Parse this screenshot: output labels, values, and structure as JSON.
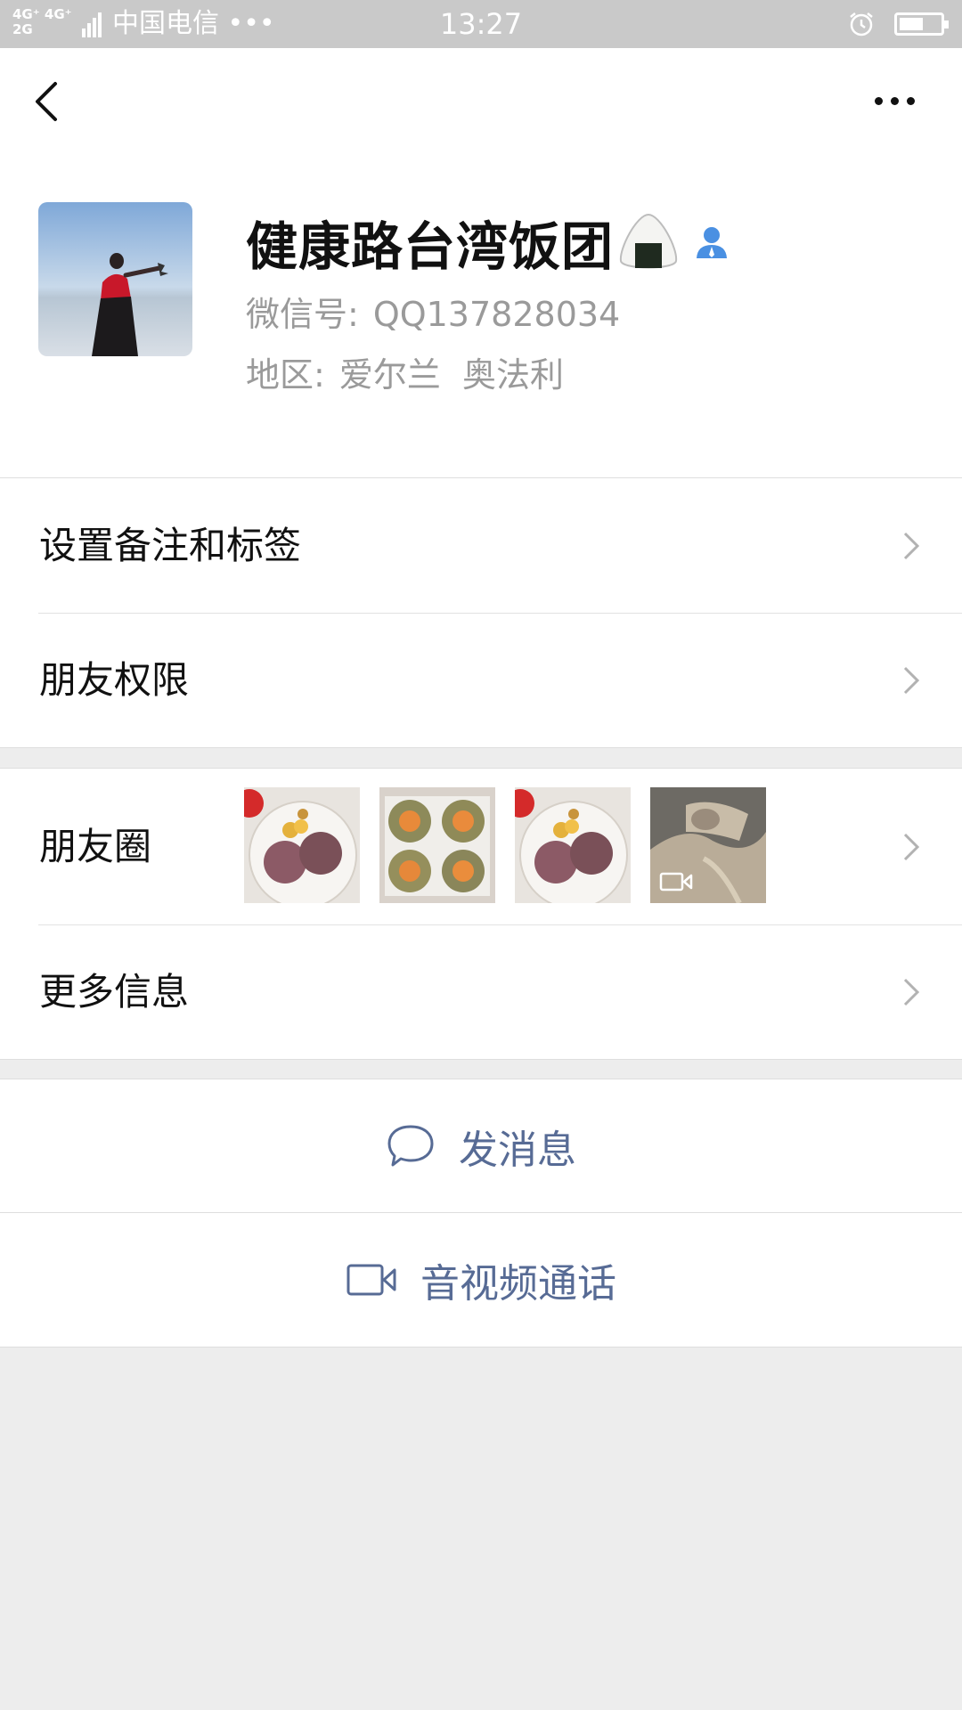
{
  "status_bar": {
    "network": "4G+ 4G\n2G",
    "carrier": "中国电信 •••",
    "time": "13:27",
    "battery_level": 0.6
  },
  "nav": {
    "back_icon": "chevron-left-icon",
    "more_icon": "more-dots-icon"
  },
  "profile": {
    "name": "健康路台湾饭团",
    "wechat_id_label": "微信号:",
    "wechat_id": "QQ137828034",
    "region_label": "地区:",
    "region": "爱尔兰  奥法利"
  },
  "menu": {
    "remark_tags": "设置备注和标签",
    "friend_permissions": "朋友权限",
    "moments": "朋友圈",
    "more_info": "更多信息"
  },
  "actions": {
    "send_message": "发消息",
    "video_call": "音视频通话"
  },
  "colors": {
    "link": "#576b95",
    "background": "#ededed"
  }
}
